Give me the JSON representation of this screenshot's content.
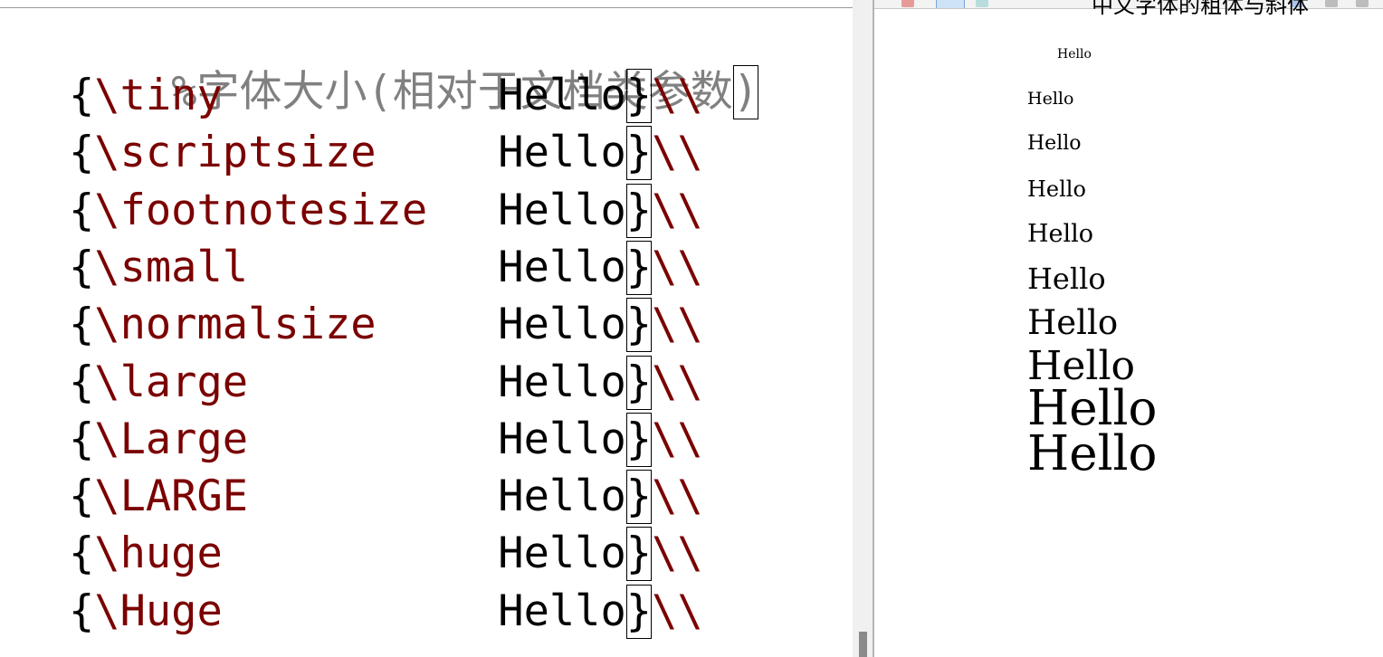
{
  "editor": {
    "comment": "%字体大小(相对于文档类参数",
    "comment_close": ")",
    "open_brace": "{",
    "close_brace": "}",
    "line_break": "\\\\",
    "lines": [
      {
        "command": "\\tiny",
        "text": "Hello"
      },
      {
        "command": "\\scriptsize",
        "text": "Hello"
      },
      {
        "command": "\\footnotesize",
        "text": "Hello"
      },
      {
        "command": "\\small",
        "text": "Hello"
      },
      {
        "command": "\\normalsize",
        "text": "Hello"
      },
      {
        "command": "\\large",
        "text": "Hello"
      },
      {
        "command": "\\Large",
        "text": "Hello"
      },
      {
        "command": "\\LARGE",
        "text": "Hello"
      },
      {
        "command": "\\huge",
        "text": "Hello"
      },
      {
        "command": "\\Huge",
        "text": "Hello"
      }
    ]
  },
  "preview": {
    "heading": "中文字体的粗体与斜体",
    "outputs": [
      "Hello",
      "Hello",
      "Hello",
      "Hello",
      "Hello",
      "Hello",
      "Hello",
      "Hello",
      "Hello",
      "Hello"
    ]
  },
  "toolbar_icons": [
    "pdf-icon",
    "zoom-icon",
    "down-arrow-icon",
    "down-arrow-icon",
    "page-icon",
    "search-icon"
  ]
}
